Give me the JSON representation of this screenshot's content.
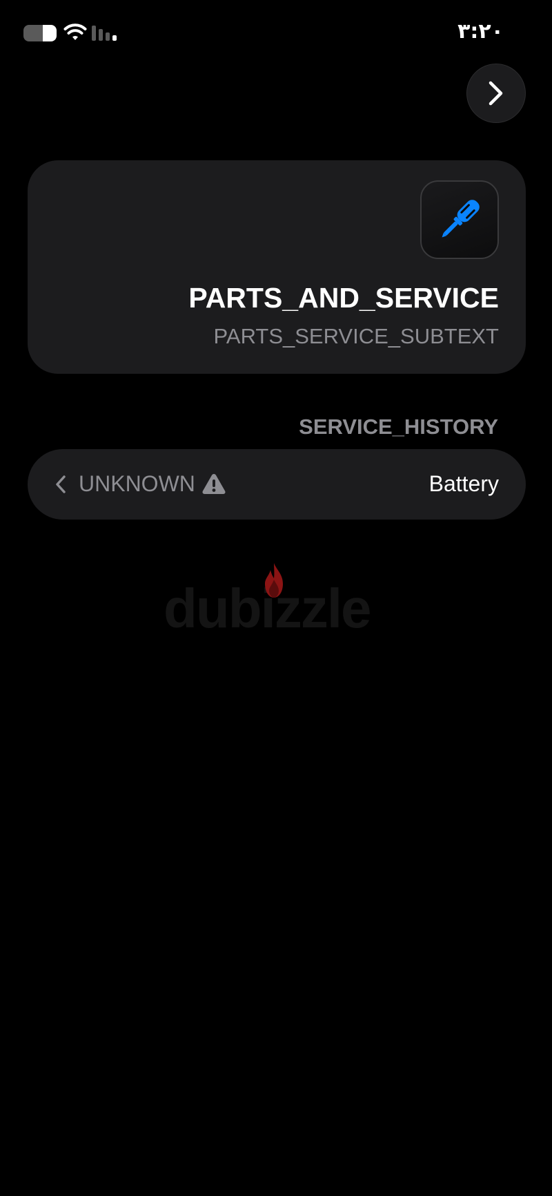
{
  "status_bar": {
    "time": "٣:٢٠",
    "battery_icon": "battery-icon",
    "wifi_icon": "wifi-icon",
    "signal_icon": "signal-icon"
  },
  "nav": {
    "forward_icon": "chevron-right-icon"
  },
  "card": {
    "icon": "screwdriver-icon",
    "icon_color": "#0a84ff",
    "title": "PARTS_AND_SERVICE",
    "subtitle": "PARTS_SERVICE_SUBTEXT"
  },
  "section": {
    "header": "SERVICE_HISTORY"
  },
  "history_row": {
    "label": "Battery",
    "value": "UNKNOWN",
    "status_icon": "warning-icon",
    "chevron_icon": "chevron-left-icon"
  },
  "watermark": {
    "text": "dubizzle",
    "flame_color": "#8b1414"
  },
  "colors": {
    "background": "#000000",
    "card": "#1c1c1e",
    "secondary_text": "#8e8e93",
    "accent": "#0a84ff"
  }
}
